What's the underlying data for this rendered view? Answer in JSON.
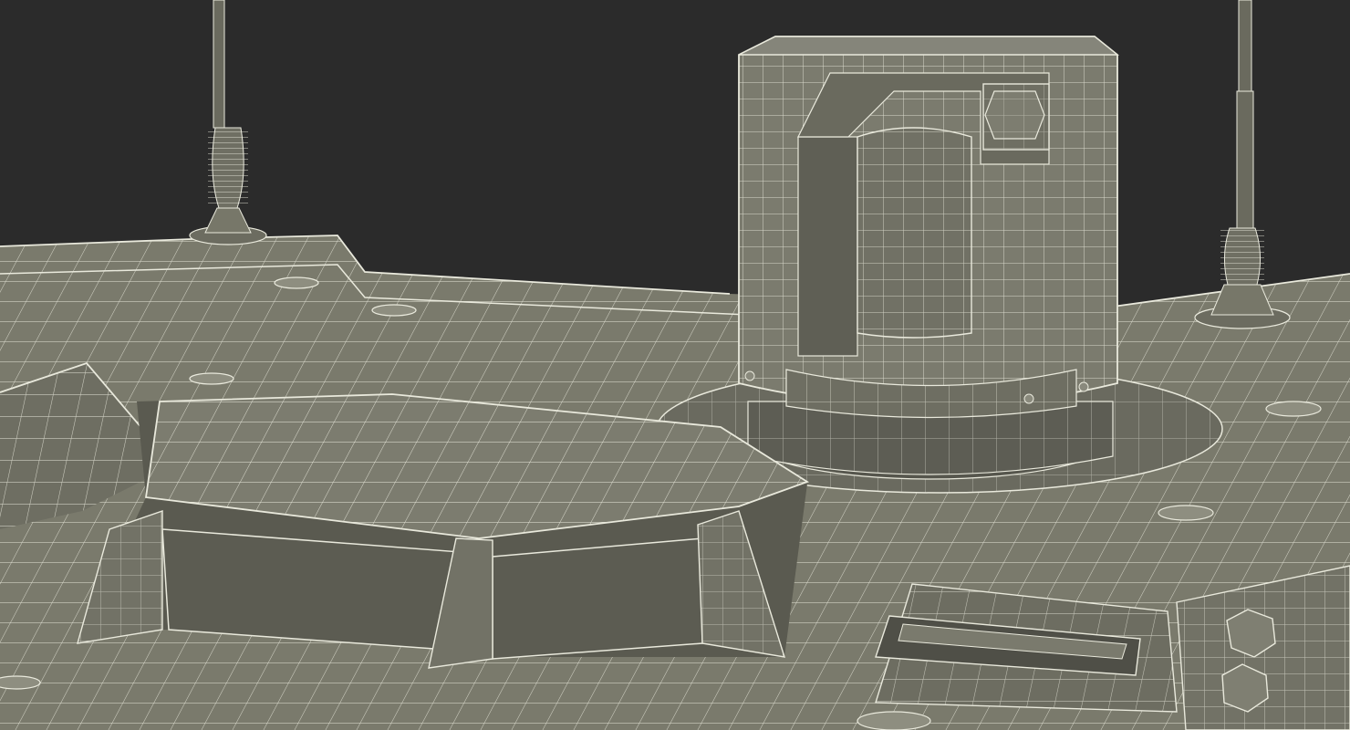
{
  "scene": {
    "subject": "wireframe-render-vehicle-top",
    "colors": {
      "background": "#2b2b2b",
      "surface": "#7a7a6c",
      "surface_light": "#85857a",
      "surface_dark": "#5f5f55",
      "surface_shadow": "#4d4d45",
      "wire": "#e9e9dc"
    }
  }
}
